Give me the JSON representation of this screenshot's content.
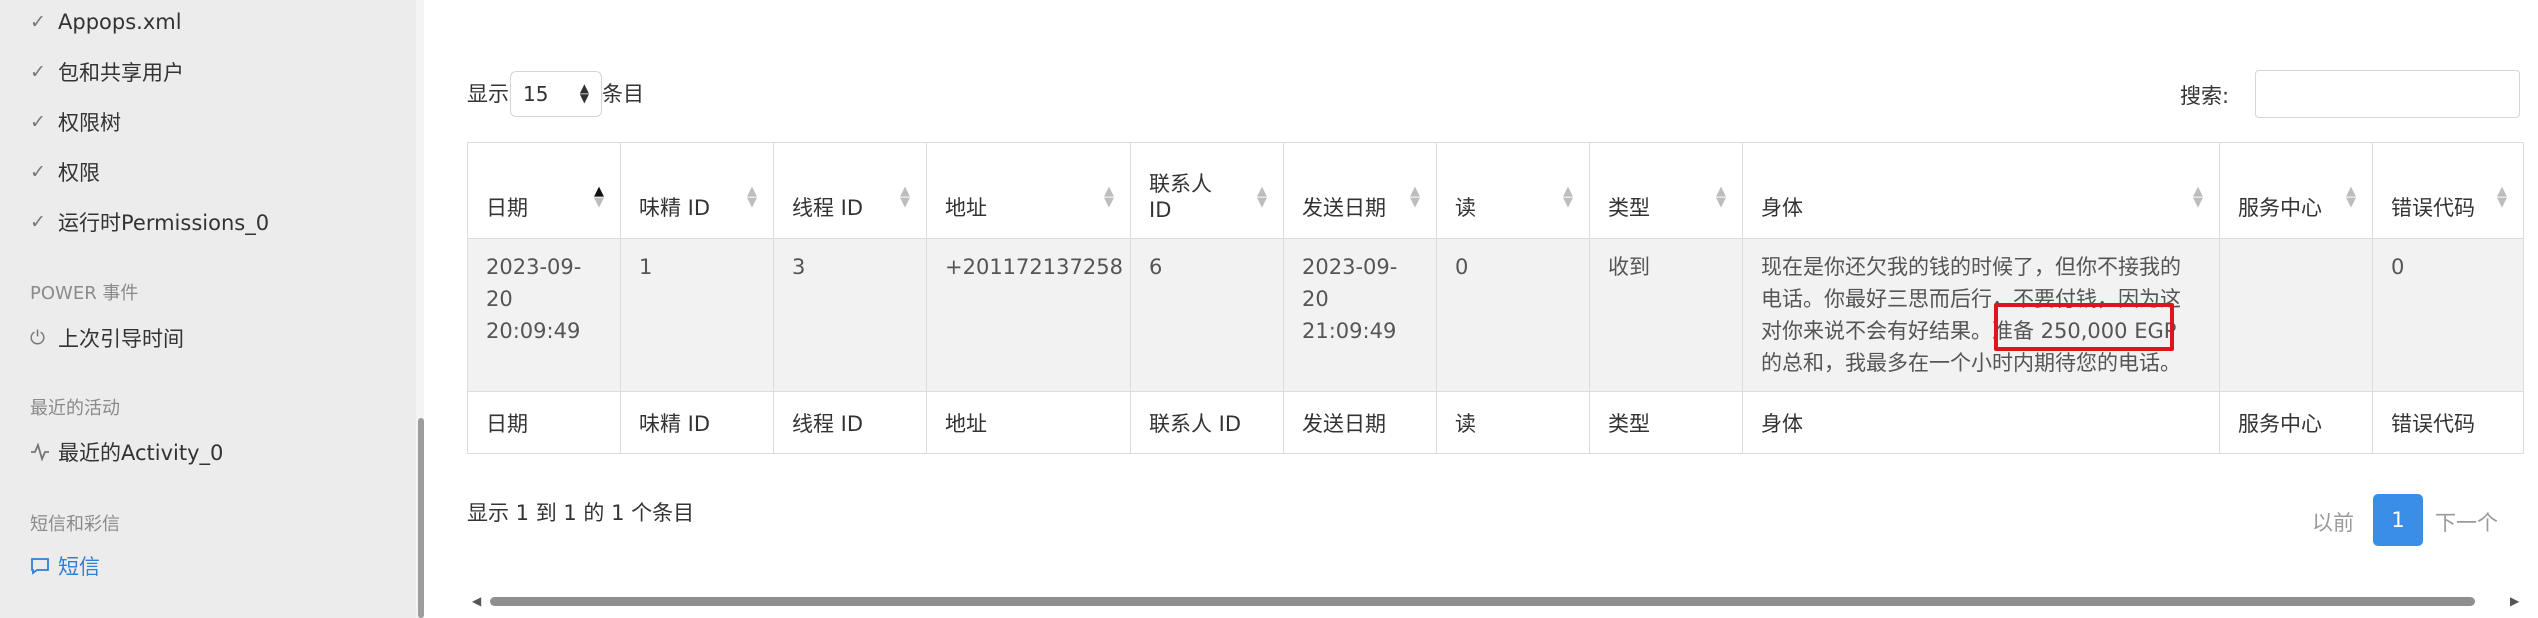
{
  "sidebar": {
    "items_top": [
      {
        "label": "Appops.xml",
        "icon": "check-icon"
      },
      {
        "label": "包和共享用户",
        "icon": "check-icon"
      },
      {
        "label": "权限树",
        "icon": "check-icon"
      },
      {
        "label": "权限",
        "icon": "check-icon"
      },
      {
        "label": "运行时Permissions_0",
        "icon": "check-icon"
      }
    ],
    "section_power": "POWER 事件",
    "item_boot": "上次引导时间",
    "section_recent": "最近的活动",
    "item_recent": "最近的Activity_0",
    "section_sms": "短信和彩信",
    "item_sms": "短信",
    "active_color": "#2f7fd3"
  },
  "controls": {
    "show_prefix": "显示",
    "page_length": "15",
    "show_suffix": "条目",
    "search_label": "搜索:",
    "search_value": ""
  },
  "table": {
    "columns": [
      "日期",
      "味精 ID",
      "线程 ID",
      "地址",
      "联系人 ID",
      "发送日期",
      "读",
      "类型",
      "身体",
      "服务中心",
      "错误代码"
    ],
    "rows": [
      {
        "date": "2023-09-20 20:09:49",
        "msg_id": "1",
        "thread_id": "3",
        "address": "+201172137258",
        "contact_id": "6",
        "sent_date": "2023-09-20 21:09:49",
        "read": "0",
        "type": "收到",
        "body": "现在是你还欠我的钱的时候了，但你不接我的电话。你最好三思而后行，不要付钱，因为这对你来说不会有好结果。准备 250,000 EGP 的总和，我最多在一个小时内期待您的电话。",
        "service_center": "",
        "error_code": "0"
      }
    ],
    "highlight_color": "#e1131d"
  },
  "footer": {
    "info": "显示 1 到 1 的 1 个条目",
    "prev": "以前",
    "current_page": "1",
    "next": "下一个",
    "accent": "#3a8ee6"
  }
}
